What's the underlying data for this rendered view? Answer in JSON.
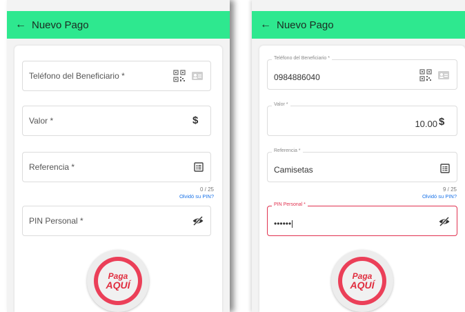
{
  "left_screen": {
    "header": {
      "back_icon": "←",
      "title": "Nuevo Pago"
    },
    "fields": {
      "phone": {
        "label": "Teléfono del Beneficiario *",
        "value": ""
      },
      "amount": {
        "label": "Valor *",
        "value": "",
        "currency_symbol": "$"
      },
      "reference": {
        "label": "Referencia *",
        "value": "",
        "counter": "0 / 25"
      },
      "pin": {
        "label": "PIN Personal *",
        "value": ""
      }
    },
    "forgot_pin": "Olvidó su PIN?",
    "pay_button": {
      "line1": "Paga",
      "line2": "AQUÍ"
    }
  },
  "right_screen": {
    "header": {
      "back_icon": "←",
      "title": "Nuevo Pago"
    },
    "fields": {
      "phone": {
        "label": "Teléfono del Beneficiario *",
        "value": "0984886040"
      },
      "amount": {
        "label": "Valor *",
        "value": "10.00",
        "currency_symbol": "$"
      },
      "reference": {
        "label": "Referencia *",
        "value": "Camisetas",
        "counter": "9 / 25"
      },
      "pin": {
        "label": "PIN Personal *",
        "value": "••••••"
      }
    },
    "forgot_pin": "Olvidó su PIN?",
    "pay_button": {
      "line1": "Paga",
      "line2": "AQUÍ"
    }
  },
  "icons": {
    "qr": "qr-code-icon",
    "contact": "contact-card-icon",
    "dollar": "dollar-icon",
    "list": "list-icon",
    "eye": "eye-off-icon"
  },
  "colors": {
    "header": "#2ee88f",
    "accent_red": "#e0304e",
    "link_blue": "#1a73e8"
  }
}
